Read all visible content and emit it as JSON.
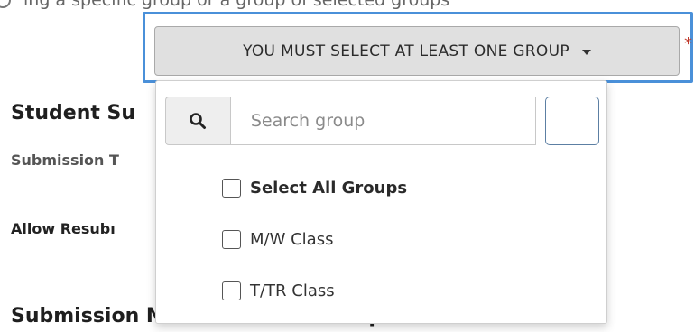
{
  "top_row": {
    "partial_text": "ing a specific group or a group of selected groups"
  },
  "background": {
    "student_heading": "Student Su",
    "submission_type_label": "Submission T",
    "allow_label": "Allow Resubı",
    "notification_heading": "Submission Notification Email Options:"
  },
  "group_select": {
    "button_label": "YOU MUST SELECT AT LEAST ONE GROUP",
    "caret_icon": "caret-down-icon",
    "required_marker": "*",
    "focus_color": "#4a90d9"
  },
  "dropdown": {
    "search": {
      "icon": "search-icon",
      "placeholder": "Search group",
      "value": ""
    },
    "options": [
      {
        "label": "Select All Groups",
        "checked": false,
        "bold": true
      },
      {
        "label": "M/W Class",
        "checked": false,
        "bold": false
      },
      {
        "label": "T/TR Class",
        "checked": false,
        "bold": false
      }
    ]
  }
}
